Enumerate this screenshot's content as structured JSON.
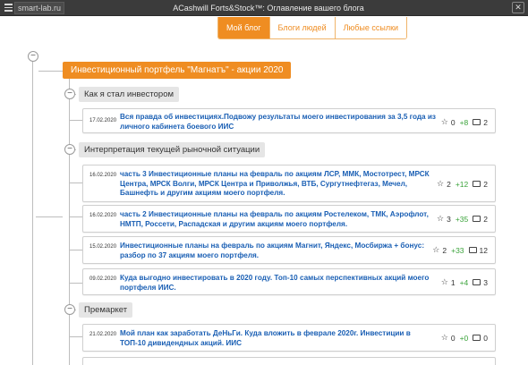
{
  "titlebar": {
    "site": "smart-lab.ru",
    "title": "АCashwill Forts&Stock™: Оглавление вашего блога",
    "close": "✕"
  },
  "tabs": [
    {
      "label": "Мой блог",
      "active": true
    },
    {
      "label": "Блоги людей",
      "active": false
    },
    {
      "label": "Любые ссылки",
      "active": false
    }
  ],
  "toggle_symbol": "−",
  "root": {
    "title": "Инвестиционный портфель \"Магнатъ\" - акции 2020"
  },
  "sections": [
    {
      "title": "Как я стал инвестором",
      "posts": [
        {
          "date": "17.02.2020",
          "title": "Вся правда об инвестициях.Подвожу результаты моего инвестирования за 3,5 года из личного кабинета боевого ИИС",
          "favorites": "0",
          "rating": "+8",
          "comments": "2"
        }
      ]
    },
    {
      "title": "Интерпретация текущей рыночной ситуации",
      "posts": [
        {
          "date": "16.02.2020",
          "title": "часть 3 Инвестиционные планы на февраль по акциям ЛСР, ММК, Мостотрест, МРСК Центра, МРСК Волги, МРСК Центра и Приволжья, ВТБ, Сургутнефтегаз, Мечел, Башнефть и другим акциям моего портфеля.",
          "favorites": "2",
          "rating": "+12",
          "comments": "2"
        },
        {
          "date": "16.02.2020",
          "title": "часть 2 Инвестиционные планы на февраль по акциям Ростелеком, ТМК, Аэрофлот, НМТП, Россети, Распадская и другим акциям моего портфеля.",
          "favorites": "3",
          "rating": "+35",
          "comments": "2"
        },
        {
          "date": "15.02.2020",
          "title": "Инвестиционные планы на февраль по акциям Магнит, Яндекс, Мосбиржа + бонус: разбор по 37 акциям моего портфеля.",
          "favorites": "2",
          "rating": "+33",
          "comments": "12"
        },
        {
          "date": "09.02.2020",
          "title": "Куда выгодно инвестировать в 2020 году. Топ-10 самых перспективных акций моего портфеля ИИС.",
          "favorites": "1",
          "rating": "+4",
          "comments": "3"
        }
      ]
    },
    {
      "title": "Премаркет",
      "posts": [
        {
          "date": "21.02.2020",
          "title": "Мой план как заработать ДеНьГи. Куда вложить в феврале 2020г. Инвестиции в ТОП-10 дивидендных акций. ИИС",
          "favorites": "0",
          "rating": "+0",
          "comments": "0"
        }
      ]
    }
  ]
}
